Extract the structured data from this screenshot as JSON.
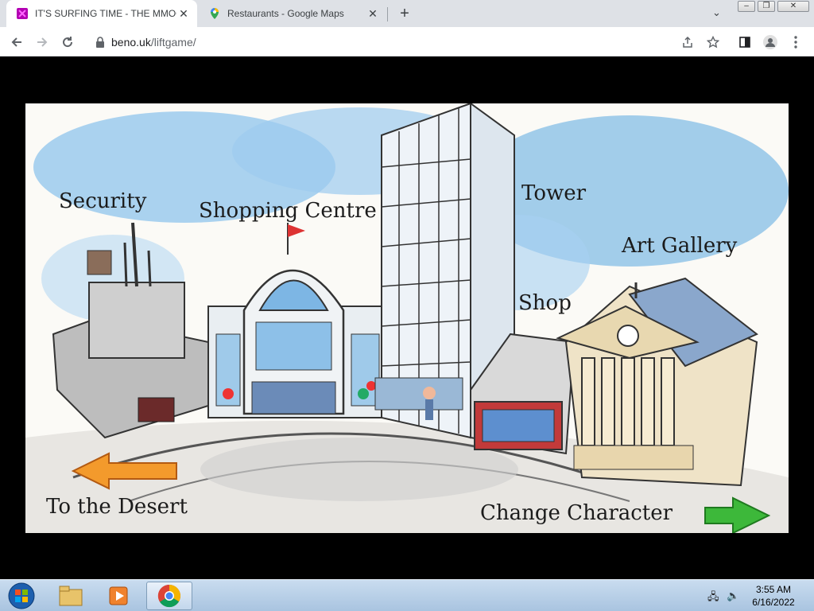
{
  "browser": {
    "tabs": [
      {
        "title": "IT'S SURFING TIME - THE MMOG",
        "favicon": "purple-game-icon",
        "active": true
      },
      {
        "title": "Restaurants - Google Maps",
        "favicon": "google-maps-pin-icon",
        "active": false
      }
    ],
    "new_tab": "+",
    "close": "✕",
    "url_host": "beno.uk",
    "url_path": "/liftgame/"
  },
  "game": {
    "labels": {
      "security": "Security",
      "shopping_centre": "Shopping Centre",
      "tower": "Tower",
      "shop": "Shop",
      "art_gallery": "Art Gallery",
      "to_desert": "To the Desert",
      "change_character": "Change Character"
    },
    "colors": {
      "sky": "#7cb9e6",
      "left_arrow": "#f39a2c",
      "right_arrow": "#3db83a"
    }
  },
  "taskbar": {
    "time": "3:55 AM",
    "date": "6/16/2022",
    "apps": [
      "start-orb",
      "file-explorer",
      "media-player",
      "chrome"
    ]
  }
}
